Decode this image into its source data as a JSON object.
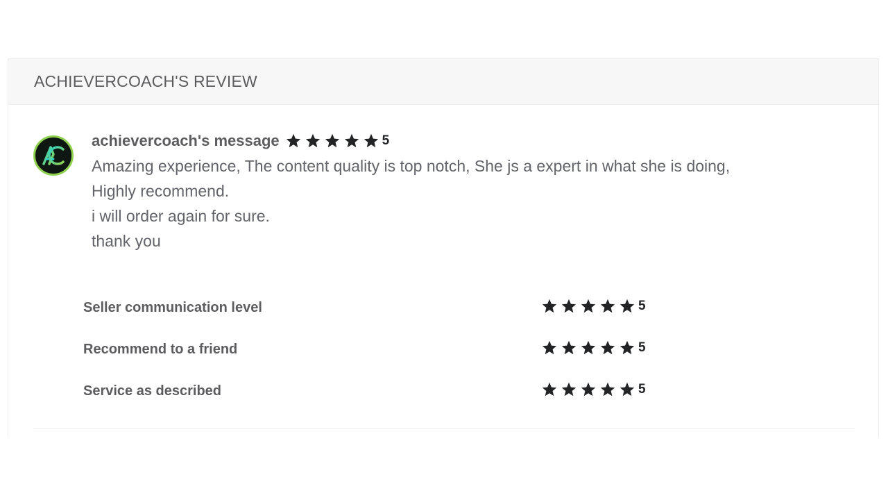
{
  "review": {
    "title": "ACHIEVERCOACH'S REVIEW",
    "author_label": "achievercoach's message",
    "overall_rating": 5,
    "overall_rating_text": "5",
    "avatar_icon": "achievercoach-logo-icon",
    "message_lines": [
      "Amazing experience, The content quality is top notch, She js a expert in what she is doing,",
      "Highly recommend.",
      "i will order again for sure.",
      "thank you"
    ]
  },
  "ratings": [
    {
      "label": "Seller communication level",
      "value": 5,
      "value_text": "5"
    },
    {
      "label": "Recommend to a friend",
      "value": 5,
      "value_text": "5"
    },
    {
      "label": "Service as described",
      "value": 5,
      "value_text": "5"
    }
  ],
  "colors": {
    "star": "#222325",
    "text": "#5c5c5f",
    "avatar_ring": "#8fd14f",
    "header_bg": "#f7f7f7"
  }
}
